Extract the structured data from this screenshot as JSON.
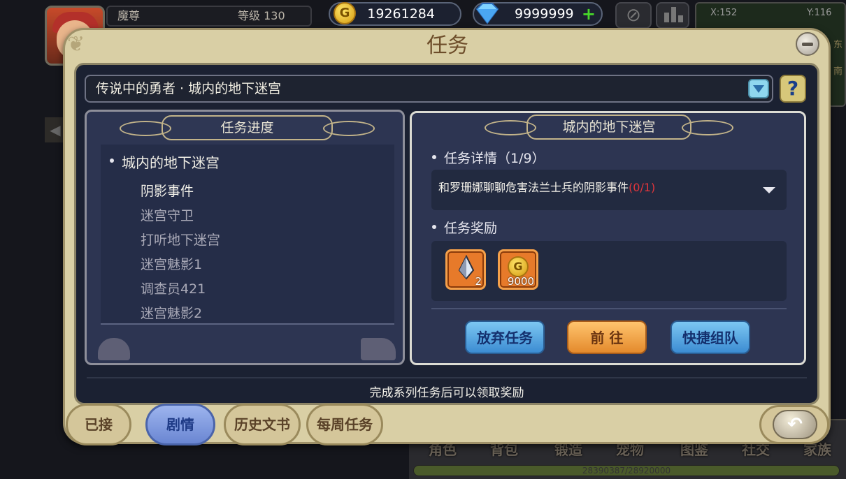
{
  "hud": {
    "player_name": "魔尊",
    "level_label": "等级",
    "level": "130",
    "gold": "19261284",
    "diamonds": "9999999",
    "plus": "+",
    "map_x": "X:152",
    "map_y": "Y:116",
    "side_east": "东",
    "side_south": "南",
    "bottom_buttons": [
      "角色",
      "背包",
      "锻造",
      "宠物",
      "图鉴",
      "社交",
      "家族"
    ],
    "xp": "28390387/28920000"
  },
  "panel": {
    "title": "任务",
    "selector": "传说中的勇者 · 城内的地下迷宫",
    "help": "?",
    "progress": {
      "title": "任务进度",
      "chapter": "城内的地下迷宫",
      "items": [
        "阴影事件",
        "迷宫守卫",
        "打听地下迷宫",
        "迷宫魅影1",
        "调查员421",
        "迷宫魅影2"
      ]
    },
    "detail": {
      "title": "城内的地下迷宫",
      "task_header": "任务详情（1/9）",
      "task_text": "和罗珊娜聊聊危害法兰士兵的阴影事件",
      "task_count": "(0/1)",
      "reward_header": "任务奖励",
      "rewards": [
        {
          "icon": "crystal-shard-icon",
          "count": "2"
        },
        {
          "icon": "gold-coin-icon",
          "count": "9000"
        }
      ],
      "buttons": {
        "abandon": "放弃任务",
        "goto": "前 往",
        "team": "快捷组队"
      }
    },
    "hint": "完成系列任务后可以领取奖励",
    "tabs": [
      "已接",
      "剧情",
      "历史文书",
      "每周任务"
    ],
    "selected_tab": "剧情"
  },
  "colors": {
    "panel_bg": "#d9cfa5",
    "inner_bg": "#1b2132",
    "accent_blue": "#3c8cd2",
    "accent_orange": "#e48a2c",
    "task_count_red": "#e0353b"
  }
}
